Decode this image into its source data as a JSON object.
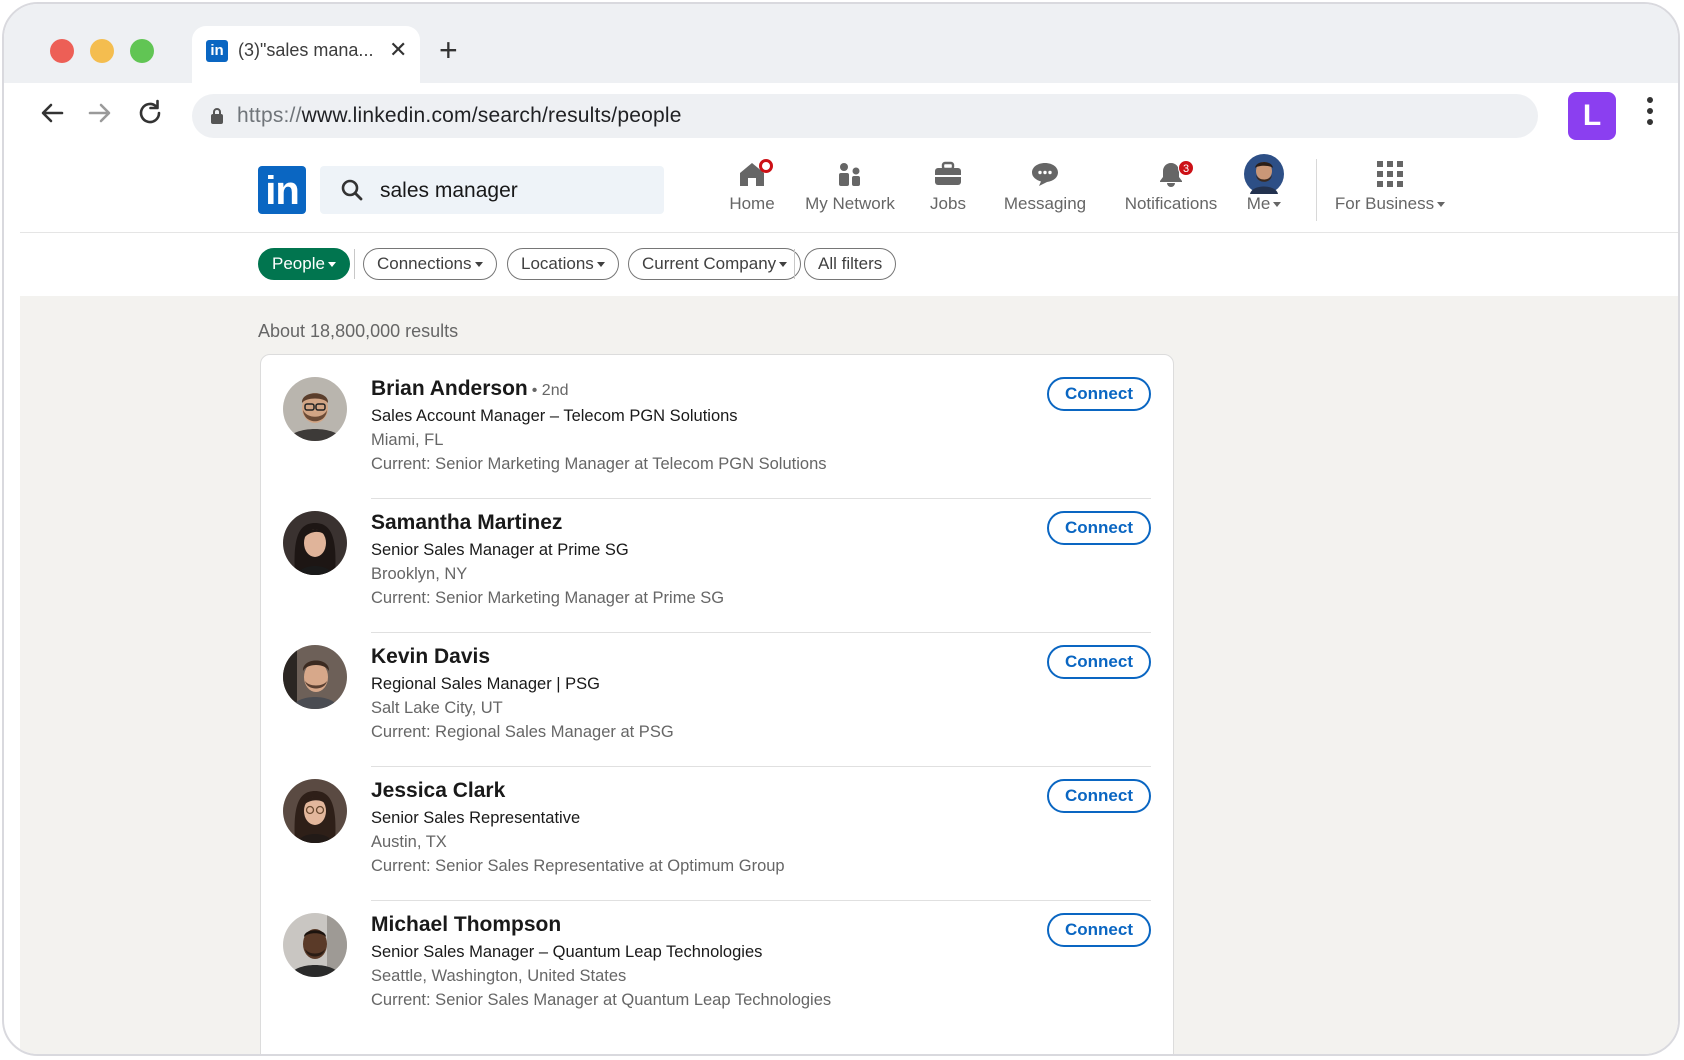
{
  "browser": {
    "tab_title": "(3)\"sales mana...",
    "tab_favicon": "in",
    "new_tab_label": "+",
    "close_tab_label": "✕",
    "url_protocol": "https://",
    "url_rest": "www.linkedin.com/search/results/people",
    "profile_initial": "L",
    "profile_color": "#8b3ff0"
  },
  "linkedin": {
    "logo_text": "in",
    "search_value": "sales manager",
    "nav": {
      "home": "Home",
      "network": "My Network",
      "jobs": "Jobs",
      "messaging": "Messaging",
      "notifications": "Notifications",
      "notifications_count": "3",
      "me": "Me",
      "business": "For Business"
    },
    "brand_color": "#0a66c2"
  },
  "filters": {
    "people": "People",
    "connections": "Connections",
    "locations": "Locations",
    "current_company": "Current Company",
    "all_filters": "All filters",
    "active_color": "#01754f"
  },
  "results": {
    "count_text": "About 18,800,000 results",
    "connect_label": "Connect",
    "items": [
      {
        "name": "Brian Anderson",
        "degree": "• 2nd",
        "headline": "Sales Account Manager  – Telecom PGN Solutions",
        "location": "Miami, FL",
        "current": "Current: Senior Marketing Manager at Telecom PGN Solutions"
      },
      {
        "name": "Samantha Martinez",
        "degree": "",
        "headline": "Senior Sales Manager at Prime SG",
        "location": "Brooklyn, NY",
        "current": "Current: Senior Marketing Manager at Prime SG"
      },
      {
        "name": "Kevin Davis",
        "degree": "",
        "headline": "Regional Sales Manager | PSG",
        "location": "Salt Lake City, UT",
        "current": "Current: Regional Sales Manager at PSG"
      },
      {
        "name": "Jessica Clark",
        "degree": "",
        "headline": "Senior Sales Representative",
        "location": "Austin, TX",
        "current": "Current: Senior Sales Representative at Optimum Group"
      },
      {
        "name": "Michael Thompson",
        "degree": "",
        "headline": "Senior Sales Manager – Quantum Leap Technologies",
        "location": "Seattle, Washington, United States",
        "current": "Current: Senior Sales Manager at Quantum Leap Technologies"
      }
    ]
  }
}
